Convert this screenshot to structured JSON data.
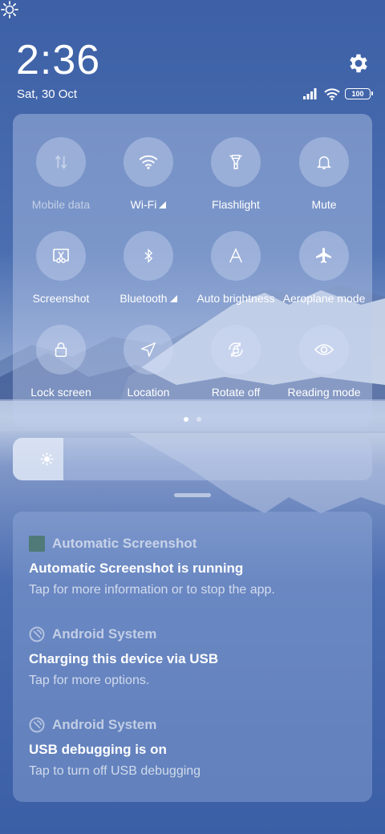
{
  "status": {
    "time": "2:36",
    "date": "Sat, 30 Oct",
    "battery": "100",
    "icons": [
      "signal-icon",
      "wifi-icon",
      "battery-icon"
    ]
  },
  "settings_icon": "gear-icon",
  "quick_settings": {
    "tiles": [
      {
        "label": "Mobile data",
        "icon": "mobile-data-icon",
        "enabled": false
      },
      {
        "label": "Wi-Fi",
        "icon": "wifi-icon",
        "enabled": true,
        "has_submenu": true
      },
      {
        "label": "Flashlight",
        "icon": "flashlight-icon",
        "enabled": true
      },
      {
        "label": "Mute",
        "icon": "bell-icon",
        "enabled": true
      },
      {
        "label": "Screenshot",
        "icon": "screenshot-icon",
        "enabled": true
      },
      {
        "label": "Bluetooth",
        "icon": "bluetooth-icon",
        "enabled": true,
        "has_submenu": true
      },
      {
        "label": "Auto brightness",
        "icon": "auto-brightness-icon",
        "enabled": true
      },
      {
        "label": "Aeroplane mode",
        "icon": "airplane-icon",
        "enabled": true
      },
      {
        "label": "Lock screen",
        "icon": "lock-icon",
        "enabled": true
      },
      {
        "label": "Location",
        "icon": "location-icon",
        "enabled": true
      },
      {
        "label": "Rotate off",
        "icon": "rotate-lock-icon",
        "enabled": true
      },
      {
        "label": "Reading mode",
        "icon": "eye-icon",
        "enabled": true
      }
    ],
    "pages": 2,
    "current_page": 1
  },
  "brightness": {
    "level": 0.14,
    "low_icon": "sun-low-icon",
    "high_icon": "sun-high-icon"
  },
  "notifications": [
    {
      "app": "Automatic Screenshot",
      "app_icon": "app-square-icon",
      "title": "Automatic Screenshot is running",
      "text": "Tap for more information or to stop the app."
    },
    {
      "app": "Android System",
      "app_icon": "android-system-icon",
      "title": "Charging this device via USB",
      "text": "Tap for more options."
    },
    {
      "app": "Android System",
      "app_icon": "android-system-icon",
      "title": "USB debugging is on",
      "text": "Tap to turn off USB debugging"
    }
  ],
  "colors": {
    "background": "#3f63a8",
    "app_square_icon": "#4f7a78"
  }
}
